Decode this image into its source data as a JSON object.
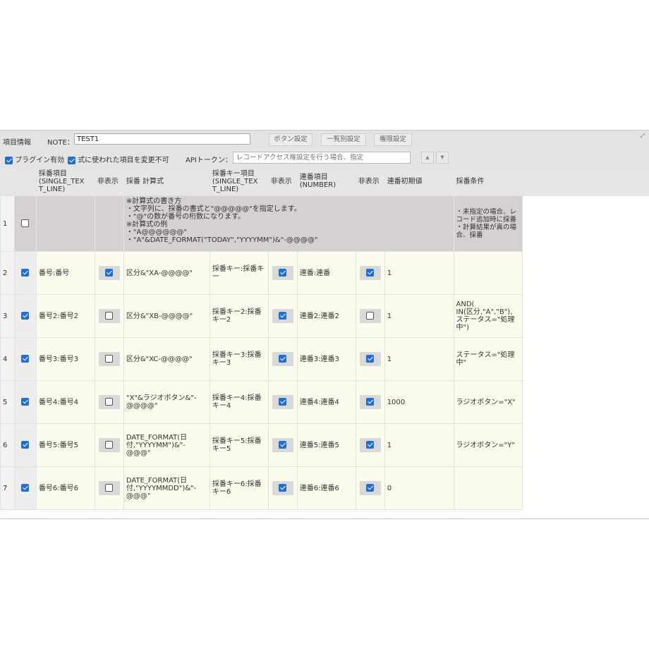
{
  "toolbar": {
    "section_label": "項目情報",
    "note_label": "NOTE：",
    "note_value": "TEST1",
    "btn_button_settings": "ボタン設定",
    "btn_list_settings": "一覧別設定",
    "btn_permission_settings": "権限設定",
    "resize_glyph": "⤢"
  },
  "options": {
    "plugin_enabled_label": "プラグイン有効",
    "plugin_enabled": true,
    "allow_change_label": "式に使われた項目を変更不可",
    "allow_change": true,
    "api_token_label": "APIトークン：",
    "api_token_placeholder": "レコードアクセス権設定を行う場合、指定",
    "up_glyph": "▲",
    "down_glyph": "▼"
  },
  "columns": [
    "",
    "",
    "採番項目\n(SINGLE_TEX\nT_LINE)",
    "非表示",
    "採番 計算式",
    "採番キー項目\n(SINGLE_TEX\nT_LINE)",
    "非表示",
    "連番項目\n(NUMBER)",
    "非表示",
    "連番初期値",
    "採番条件"
  ],
  "note_row": {
    "num": "1",
    "formula_help": "※計算式の書き方\n・文字列に、採番の書式と\"@@@@@\"を指定します。\n・\"@\"の数が番号の桁数になります。\n※計算式の例\n・\"A@@@@@@\"\n・\"A\"&DATE_FORMAT(\"TODAY\",\"YYYYMM\")&\"-@@@@\"",
    "condition_help": "・未指定の場合、レコード追加時に採番\n・計算結果が真の場合、採番"
  },
  "rows": [
    {
      "num": "2",
      "enabled": true,
      "field": "番号:番号",
      "hide1": true,
      "formula": "区分&\"XA-@@@@\"",
      "key": "採番キー:採番キー",
      "hide2": true,
      "seq": "連番:連番",
      "hide3": true,
      "init": "1",
      "cond": ""
    },
    {
      "num": "3",
      "enabled": true,
      "field": "番号2:番号2",
      "hide1": false,
      "formula": "区分&\"XB-@@@@\"",
      "key": "採番キー2:採番キー2",
      "hide2": true,
      "seq": "連番2:連番2",
      "hide3": false,
      "init": "1",
      "cond": "AND(\nIN(区分,\"A\",\"B\"),\nステータス=\"処理中\")"
    },
    {
      "num": "4",
      "enabled": true,
      "field": "番号3:番号3",
      "hide1": false,
      "formula": "区分&\"XC-@@@@\"",
      "key": "採番キー3:採番キー3",
      "hide2": true,
      "seq": "連番3:連番3",
      "hide3": true,
      "init": "1",
      "cond": "ステータス=\"処理中\""
    },
    {
      "num": "5",
      "enabled": true,
      "field": "番号4:番号4",
      "hide1": false,
      "formula": "\"X\"&ラジオボタン&\"-@@@@\"",
      "key": "採番キー4:採番キー4",
      "hide2": true,
      "seq": "連番4:連番4",
      "hide3": true,
      "init": "1000",
      "cond": "ラジオボタン=\"X\""
    },
    {
      "num": "6",
      "enabled": true,
      "field": "番号5:番号5",
      "hide1": false,
      "formula": "DATE_FORMAT(日付,\"YYYYMM\")&\"-@@@\"",
      "key": "採番キー5:採番キー5",
      "hide2": true,
      "seq": "連番5:連番5",
      "hide3": true,
      "init": "1",
      "cond": "ラジオボタン=\"Y\""
    },
    {
      "num": "7",
      "enabled": true,
      "field": "番号6:番号6",
      "hide1": false,
      "formula": "DATE_FORMAT(日付,\"YYYYMMDD\")&\"-@@@\"",
      "key": "採番キー6:採番キー6",
      "hide2": true,
      "seq": "連番6:連番6",
      "hide3": true,
      "init": "0",
      "cond": ""
    }
  ]
}
